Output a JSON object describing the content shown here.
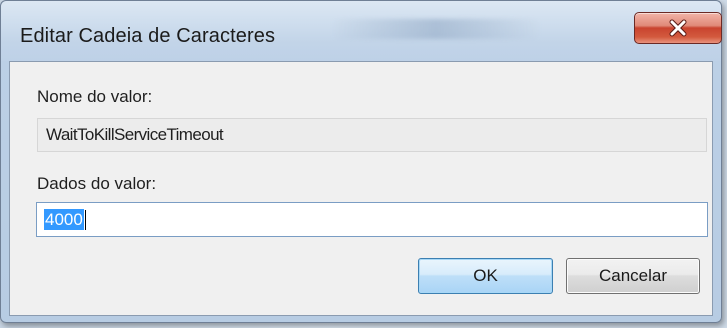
{
  "window": {
    "title": "Editar Cadeia de Caracteres"
  },
  "fields": {
    "name_label": "Nome do valor:",
    "name_value": "WaitToKillServiceTimeout",
    "data_label": "Dados do valor:",
    "data_value": "4000"
  },
  "buttons": {
    "ok_label": "OK",
    "cancel_label": "Cancelar"
  },
  "icons": {
    "close": "close-icon"
  },
  "colors": {
    "selection": "#3399ff",
    "close_button": "#c9442f",
    "default_button_border": "#3c7fb1"
  }
}
